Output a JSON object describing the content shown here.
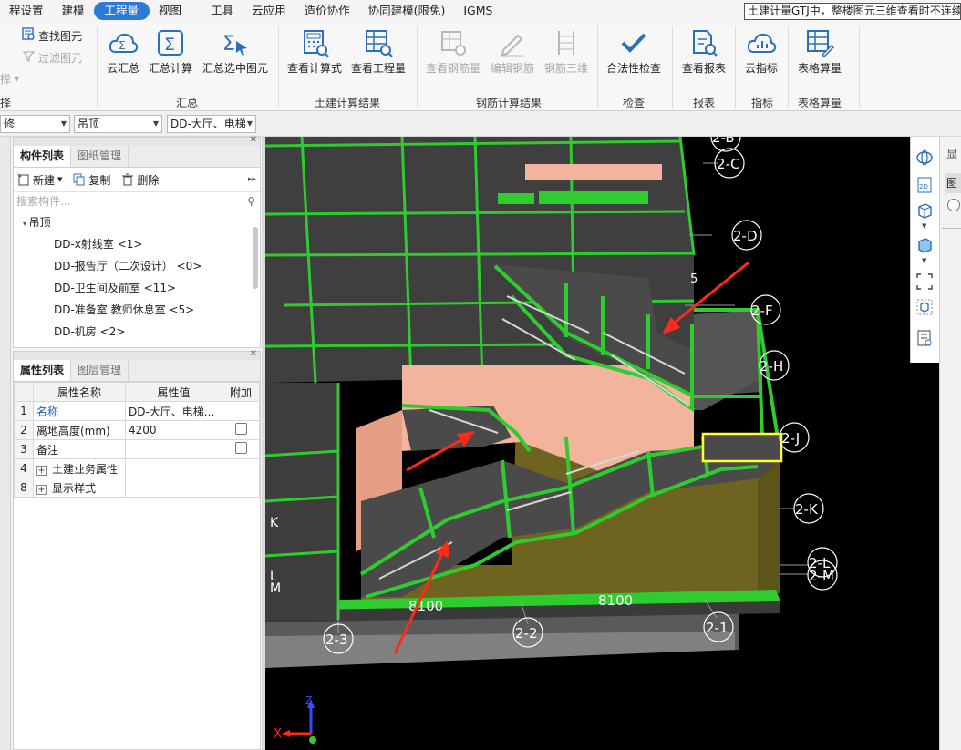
{
  "menu": {
    "items": [
      "程设置",
      "建模",
      "工程量",
      "视图",
      "工具",
      "云应用",
      "造价协作",
      "协同建模(限免)",
      "IGMS"
    ],
    "active": "工程量",
    "marquee": "土建计量GTJ中，整楼图元三维查看时不连续"
  },
  "ribbon": {
    "left_small": {
      "find": "查找图元",
      "filter": "过滤图元",
      "cut_label": "择",
      "cut_group": "择"
    },
    "summary": {
      "cloud": "云汇总",
      "calc": "汇总计算",
      "selected": "汇总选中图元",
      "group": "汇总"
    },
    "civil": {
      "formula": "查看计算式",
      "quantity": "查看工程量",
      "group": "土建计算结果"
    },
    "rebar": {
      "amount": "查看钢筋量",
      "edit": "编辑钢筋",
      "view3d": "钢筋三维",
      "group": "钢筋计算结果"
    },
    "check": {
      "legal": "合法性检查",
      "group": "检查"
    },
    "report": {
      "view": "查看报表",
      "group": "报表"
    },
    "index": {
      "cloud": "云指标",
      "group": "指标"
    },
    "table": {
      "calc": "表格算量",
      "group": "表格算量"
    }
  },
  "filter": {
    "dd1": "修",
    "dd2": "吊顶",
    "dd3": "DD-大厅、电梯"
  },
  "component_panel": {
    "tabs": [
      "构件列表",
      "图纸管理"
    ],
    "toolbar": {
      "new": "新建",
      "copy": "复制",
      "delete": "删除"
    },
    "search_placeholder": "搜索构件...",
    "root": "吊顶",
    "items": [
      "DD-x射线室 <1>",
      "DD-报告厅（二次设计） <0>",
      "DD-卫生间及前室 <11>",
      "DD-准备室 教师休息室 <5>",
      "DD-机房 <2>"
    ]
  },
  "property_panel": {
    "tabs": [
      "属性列表",
      "图层管理"
    ],
    "headers": [
      "属性名称",
      "属性值",
      "附加"
    ],
    "rows": [
      {
        "n": "1",
        "name": "名称",
        "value": "DD-大厅、电梯..."
      },
      {
        "n": "2",
        "name": "离地高度(mm)",
        "value": "4200"
      },
      {
        "n": "3",
        "name": "备注",
        "value": ""
      },
      {
        "n": "4",
        "name": "土建业务属性",
        "value": ""
      },
      {
        "n": "8",
        "name": "显示样式",
        "value": ""
      }
    ]
  },
  "viewport": {
    "axis_labels_right": [
      "2-B",
      "2-C",
      "2-D",
      "2-F",
      "2-H",
      "2-J",
      "2-K",
      "2-L",
      "2-M"
    ],
    "axis_labels_bottom": [
      "2-3",
      "2-2",
      "2-1"
    ],
    "dimensions": [
      "8100",
      "8100"
    ],
    "left_partial": [
      "K",
      "L",
      "M"
    ],
    "side_mark": "5",
    "axes": {
      "x": "X",
      "z": "Z"
    },
    "colors": {
      "green": "#2ecc2e",
      "slab": "#4d4d4d",
      "wall": "#6e6420",
      "salmon": "#f2b49c",
      "red_arrow": "#ff2a1a"
    }
  },
  "right_panel": {
    "chars": [
      "显",
      "图"
    ]
  }
}
